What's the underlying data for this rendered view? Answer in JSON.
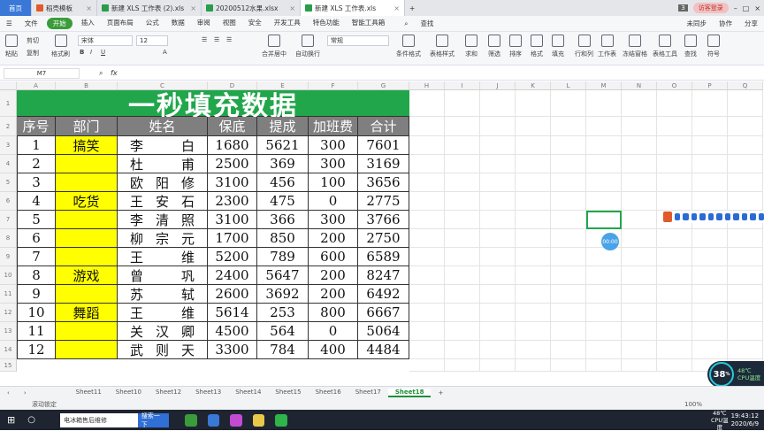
{
  "window": {
    "tabs": [
      {
        "label": "首页",
        "kind": "home"
      },
      {
        "label": "稻壳模板",
        "kind": "doc"
      },
      {
        "label": "新建 XLS 工作表 (2).xls",
        "kind": "xls"
      },
      {
        "label": "20200512水果.xlsx",
        "kind": "xls"
      },
      {
        "label": "新建 XLS 工作表.xls",
        "kind": "xls",
        "active": true
      }
    ],
    "new_tab": "+",
    "badge": "3",
    "login_label": "访客登录"
  },
  "menubar": {
    "file": "文件",
    "items": [
      "开始",
      "插入",
      "页面布局",
      "公式",
      "数据",
      "审阅",
      "视图",
      "安全",
      "开发工具",
      "特色功能",
      "智能工具箱"
    ],
    "search": "查找",
    "right": [
      "未同步",
      "协作",
      "分享"
    ]
  },
  "ribbon": {
    "paste": "粘贴",
    "cut": "剪切",
    "copy": "复制",
    "format_painter": "格式刷",
    "font_name": "宋体",
    "font_size": "12",
    "number_format": "常规",
    "merge": "合并居中",
    "wrap": "自动换行",
    "groups": [
      "条件格式",
      "表格样式",
      "求和",
      "筛选",
      "排序",
      "格式",
      "填充",
      "行和列",
      "工作表",
      "冻结窗格",
      "表格工具",
      "查找",
      "符号"
    ]
  },
  "formula_bar": {
    "cell_ref": "M7",
    "fx": "fx",
    "value": ""
  },
  "columns": [
    "A",
    "B",
    "C",
    "D",
    "E",
    "F",
    "G",
    "H",
    "I",
    "J",
    "K",
    "L",
    "M",
    "N",
    "O",
    "P",
    "Q"
  ],
  "rows": [
    "1",
    "2",
    "3",
    "4",
    "5",
    "6",
    "7",
    "8",
    "9",
    "10",
    "11",
    "12",
    "13",
    "14",
    "15"
  ],
  "table": {
    "title": "一秒填充数据",
    "headers": [
      "序号",
      "部门",
      "姓名",
      "保底",
      "提成",
      "加班费",
      "合计"
    ],
    "rows": [
      {
        "no": "1",
        "dept": "搞笑",
        "name": [
          "李",
          "白"
        ],
        "base": "1680",
        "comm": "5621",
        "ot": "300",
        "total": "7601"
      },
      {
        "no": "2",
        "dept": "",
        "name": [
          "杜",
          "甫"
        ],
        "base": "2500",
        "comm": "369",
        "ot": "300",
        "total": "3169"
      },
      {
        "no": "3",
        "dept": "",
        "name": [
          "欧",
          "阳",
          "修"
        ],
        "base": "3100",
        "comm": "456",
        "ot": "100",
        "total": "3656"
      },
      {
        "no": "4",
        "dept": "吃货",
        "name": [
          "王",
          "安",
          "石"
        ],
        "base": "2300",
        "comm": "475",
        "ot": "0",
        "total": "2775"
      },
      {
        "no": "5",
        "dept": "",
        "name": [
          "李",
          "清",
          "照"
        ],
        "base": "3100",
        "comm": "366",
        "ot": "300",
        "total": "3766"
      },
      {
        "no": "6",
        "dept": "",
        "name": [
          "柳",
          "宗",
          "元"
        ],
        "base": "1700",
        "comm": "850",
        "ot": "200",
        "total": "2750"
      },
      {
        "no": "7",
        "dept": "",
        "name": [
          "王",
          "维"
        ],
        "base": "5200",
        "comm": "789",
        "ot": "600",
        "total": "6589"
      },
      {
        "no": "8",
        "dept": "游戏",
        "name": [
          "曾",
          "巩"
        ],
        "base": "2400",
        "comm": "5647",
        "ot": "200",
        "total": "8247"
      },
      {
        "no": "9",
        "dept": "",
        "name": [
          "苏",
          "轼"
        ],
        "base": "2600",
        "comm": "3692",
        "ot": "200",
        "total": "6492"
      },
      {
        "no": "10",
        "dept": "舞蹈",
        "name": [
          "王",
          "维"
        ],
        "base": "5614",
        "comm": "253",
        "ot": "800",
        "total": "6667"
      },
      {
        "no": "11",
        "dept": "",
        "name": [
          "关",
          "汉",
          "卿"
        ],
        "base": "4500",
        "comm": "564",
        "ot": "0",
        "total": "5064"
      },
      {
        "no": "12",
        "dept": "",
        "name": [
          "武",
          "则",
          "天"
        ],
        "base": "3300",
        "comm": "784",
        "ot": "400",
        "total": "4484"
      }
    ]
  },
  "colors": {
    "title_bg": "#21a64b",
    "header_bg": "#7f7f7f",
    "dept_bg": "#ffff00",
    "accent": "#3a9c3a"
  },
  "sheet_tabs": [
    "Sheet11",
    "Sheet10",
    "Sheet12",
    "Sheet13",
    "Sheet14",
    "Sheet15",
    "Sheet16",
    "Sheet17",
    "Sheet18"
  ],
  "active_sheet": "Sheet18",
  "status": {
    "left": "滚动锁定",
    "zoom": "100%"
  },
  "recorder": "00:00",
  "cpu": {
    "percent": "38",
    "unit": "%",
    "temp": "48℃",
    "label": "CPU温度"
  },
  "taskbar": {
    "search_text": "电冰箱售后维修",
    "search_btn": "搜索一下",
    "temp": "48℃",
    "cpu_label": "CPU温度",
    "time": "19:43:12",
    "date": "2020/6/9"
  }
}
